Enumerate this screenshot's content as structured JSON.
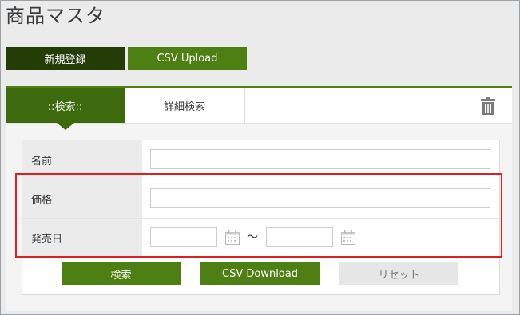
{
  "page": {
    "title": "商品マスタ"
  },
  "toolbar": {
    "new_label": "新規登録",
    "upload_label": "CSV Upload"
  },
  "tabs": {
    "search_label": "::検索::",
    "detail_label": "詳細検索"
  },
  "form": {
    "name_label": "名前",
    "name_value": "",
    "price_label": "価格",
    "price_value": "",
    "release_label": "発売日",
    "date_from": "",
    "date_to": "",
    "range_sep": "～"
  },
  "actions": {
    "search_label": "検索",
    "download_label": "CSV Download",
    "reset_label": "リセット"
  },
  "icons": {
    "trash": "trash-icon",
    "calendar": "calendar-icon"
  },
  "colors": {
    "accent": "#4e7f13",
    "accent_dark": "#243d06",
    "highlight": "#e11d1d"
  }
}
